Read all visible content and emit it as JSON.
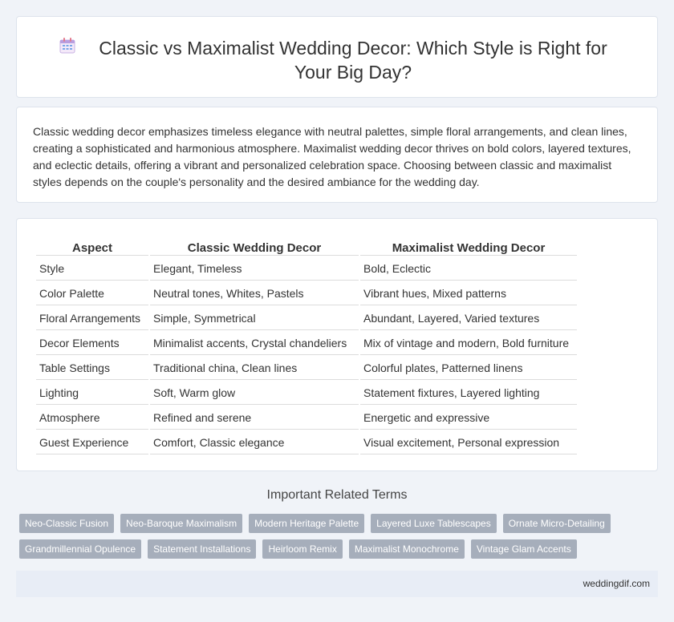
{
  "header": {
    "title": "Classic vs Maximalist Wedding Decor: Which Style is Right for Your Big Day?",
    "icon": "calendar-icon"
  },
  "intro": {
    "text": "Classic wedding decor emphasizes timeless elegance with neutral palettes, simple floral arrangements, and clean lines, creating a sophisticated and harmonious atmosphere. Maximalist wedding decor thrives on bold colors, layered textures, and eclectic details, offering a vibrant and personalized celebration space. Choosing between classic and maximalist styles depends on the couple's personality and the desired ambiance for the wedding day."
  },
  "table": {
    "headers": [
      "Aspect",
      "Classic Wedding Decor",
      "Maximalist Wedding Decor"
    ],
    "rows": [
      [
        "Style",
        "Elegant, Timeless",
        "Bold, Eclectic"
      ],
      [
        "Color Palette",
        "Neutral tones, Whites, Pastels",
        "Vibrant hues, Mixed patterns"
      ],
      [
        "Floral Arrangements",
        "Simple, Symmetrical",
        "Abundant, Layered, Varied textures"
      ],
      [
        "Decor Elements",
        "Minimalist accents, Crystal chandeliers",
        "Mix of vintage and modern, Bold furniture"
      ],
      [
        "Table Settings",
        "Traditional china, Clean lines",
        "Colorful plates, Patterned linens"
      ],
      [
        "Lighting",
        "Soft, Warm glow",
        "Statement fixtures, Layered lighting"
      ],
      [
        "Atmosphere",
        "Refined and serene",
        "Energetic and expressive"
      ],
      [
        "Guest Experience",
        "Comfort, Classic elegance",
        "Visual excitement, Personal expression"
      ]
    ]
  },
  "related": {
    "title": "Important Related Terms",
    "tags_row1": [
      "Neo-Classic Fusion",
      "Neo-Baroque Maximalism",
      "Modern Heritage Palette",
      "Layered Luxe Tablescapes",
      "Ornate Micro-Detailing"
    ],
    "tags_row2": [
      "Grandmillennial Opulence",
      "Statement Installations",
      "Heirloom Remix",
      "Maximalist Monochrome",
      "Vintage Glam Accents"
    ]
  },
  "footer": {
    "site": "weddingdif.com"
  },
  "colors": {
    "background": "#f0f3f8",
    "tag": "#a6aebb",
    "footer": "#e8edf6"
  }
}
